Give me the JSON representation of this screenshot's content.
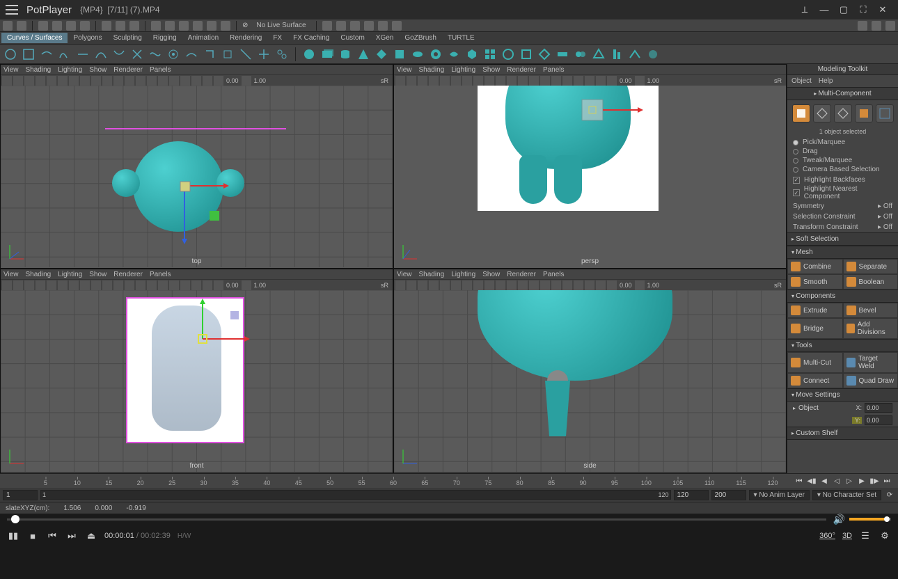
{
  "player": {
    "app_name": "PotPlayer",
    "codec_tag": "{MP4}",
    "file_label": "[7/11] (7).MP4",
    "current_time": "00:00:01",
    "duration": "00:02:39",
    "hw_label": "H/W",
    "btn_360": "360°",
    "btn_3d": "3D"
  },
  "maya": {
    "no_live": "No Live Surface",
    "shelf_tabs": [
      "Curves / Surfaces",
      "Polygons",
      "Sculpting",
      "Rigging",
      "Animation",
      "Rendering",
      "FX",
      "FX Caching",
      "Custom",
      "XGen",
      "GoZBrush",
      "TURTLE"
    ],
    "vp_menu": [
      "View",
      "Shading",
      "Lighting",
      "Show",
      "Renderer",
      "Panels"
    ],
    "vp_num1": "0.00",
    "vp_num2": "1.00",
    "vp_sR": "sR",
    "vp_labels": {
      "top": "top",
      "persp": "persp",
      "front": "front",
      "side": "side"
    },
    "timeline_ticks": [
      5,
      10,
      15,
      20,
      25,
      30,
      35,
      40,
      45,
      50,
      55,
      60,
      65,
      70,
      75,
      80,
      85,
      90,
      95,
      100,
      105,
      110,
      115,
      120
    ],
    "frame_start": "1",
    "frame_end": "120",
    "range_end": "120",
    "range_total": "200",
    "anim_layer": "No Anim Layer",
    "char_set": "No Character Set",
    "status_label": "slateXYZ(cm):",
    "status_vals": [
      "1.506",
      "0.000",
      "-0.919"
    ]
  },
  "toolkit": {
    "title": "Modeling Toolkit",
    "menu": [
      "Object",
      "Help"
    ],
    "multi_comp": "Multi-Component",
    "selected": "1 object selected",
    "sel_modes": [
      "Pick/Marquee",
      "Drag",
      "Tweak/Marquee",
      "Camera Based Selection"
    ],
    "checks": [
      "Highlight Backfaces",
      "Highlight Nearest Component"
    ],
    "symmetry_lbl": "Symmetry",
    "symmetry_val": "Off",
    "selcon_lbl": "Selection Constraint",
    "selcon_val": "Off",
    "xform_lbl": "Transform Constraint",
    "xform_val": "Off",
    "soft_sel": "Soft Selection",
    "mesh_hdr": "Mesh",
    "mesh_tools": [
      "Combine",
      "Separate",
      "Smooth",
      "Boolean"
    ],
    "comp_hdr": "Components",
    "comp_tools": [
      "Extrude",
      "Bevel",
      "Bridge",
      "Add Divisions"
    ],
    "tools_hdr": "Tools",
    "tools_list": [
      "Multi-Cut",
      "Target Weld",
      "Connect",
      "Quad Draw"
    ],
    "move_hdr": "Move Settings",
    "move_obj": "Object",
    "x_lbl": "X:",
    "x_val": "0.00",
    "y_lbl": "Y:",
    "y_val": "0.00",
    "shelf": "Custom Shelf"
  }
}
